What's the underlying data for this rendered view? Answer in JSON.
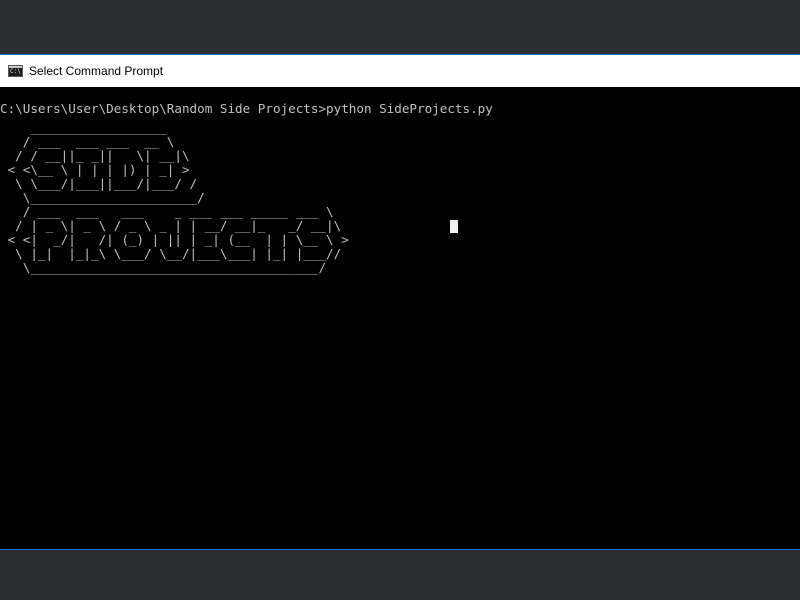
{
  "window": {
    "title": "Select Command Prompt",
    "icon_text": "C:\\"
  },
  "console": {
    "prompt": "C:\\Users\\User\\Desktop\\Random Side Projects>python SideProjects.py",
    "ascii_art": "    __________________\n   / ___  ___ ___  __ \\\n  / / __||_ _||   \\| __|\\\n < <\\__ \\ | | | |) | _| >\n  \\ \\___/|___||___/|___/ /\n   \\______________________/\n   / ___  ___   ___    _ ___ ___ _____ ___ \\\n  / | _ \\| _ \\ / _ \\ _ | | __/ __|_   _/ __|\\\n < <|  _/|   /| (_) | || | _| (__  | | \\__ \\ >\n  \\ |_|  |_|_\\ \\___/ \\__/|___\\___| |_| |___//\n   \\______________________________________/"
  },
  "colors": {
    "terminal_bg": "#000000",
    "terminal_text": "#c0c0c0",
    "titlebar_bg": "#ffffff",
    "desktop_bg": "#2b2e35",
    "window_accent": "#1f6fbf"
  }
}
